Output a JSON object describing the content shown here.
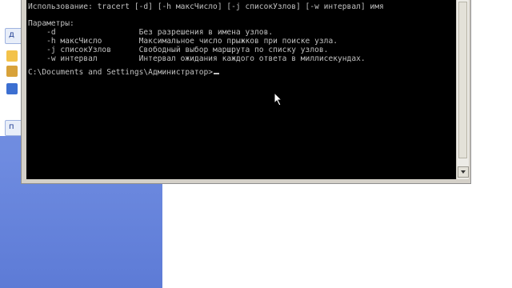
{
  "console": {
    "usage_line": "Использование: tracert [-d] [-h максЧисло] [-j списокУзлов] [-w интервал] имя",
    "params_header": "Параметры:",
    "params": [
      {
        "flag": "    -d                  ",
        "desc": "Без разрешения в имена узлов."
      },
      {
        "flag": "    -h максЧисло        ",
        "desc": "Максимальное число прыжков при поиске узла."
      },
      {
        "flag": "    -j списокУзлов      ",
        "desc": "Свободный выбор маршрута по списку узлов."
      },
      {
        "flag": "    -w интервал         ",
        "desc": "Интервал ожидания каждого ответа в миллисекундах."
      }
    ],
    "prompt": "C:\\Documents and Settings\\Администратор>"
  },
  "sidebar": {
    "item1_label": "д",
    "item2_label": "п"
  },
  "colors": {
    "console_bg": "#000000",
    "console_text": "#c0c0c0",
    "xp_blue": "#6e8be0"
  },
  "icons": [
    "mouse-cursor-icon",
    "scroll-down-arrow-icon"
  ]
}
